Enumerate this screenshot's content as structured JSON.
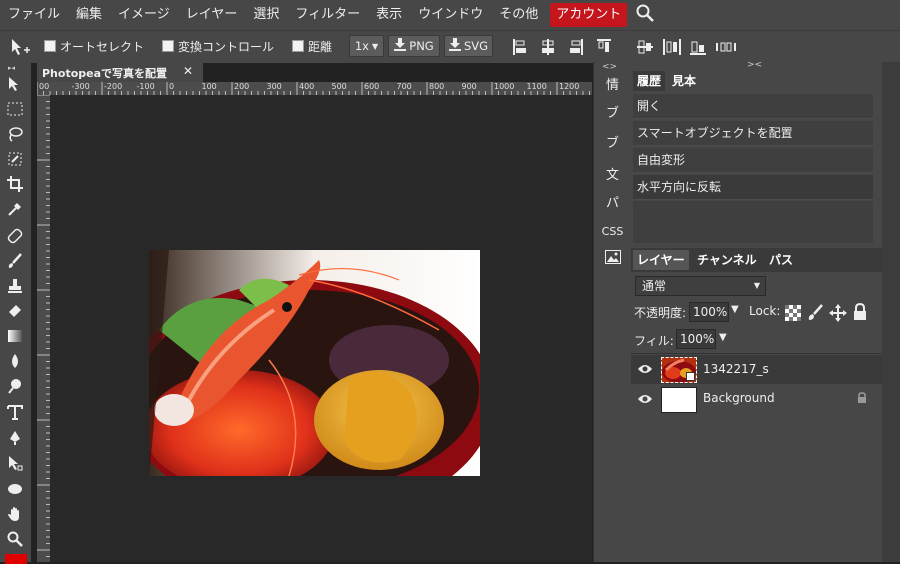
{
  "menu": {
    "items": [
      "ファイル",
      "編集",
      "イメージ",
      "レイヤー",
      "選択",
      "フィルター",
      "表示",
      "ウインドウ",
      "その他"
    ],
    "account": "アカウント"
  },
  "options": {
    "auto_select": "オートセレクト",
    "transform_controls": "変換コントロール",
    "distance": "距離",
    "zoom_select": "1x",
    "png_button": "PNG",
    "svg_button": "SVG"
  },
  "document": {
    "tab_title": "Photopeaで写真を配置",
    "close_glyph": "✕",
    "ruler_ticks": [
      "00",
      "-300",
      "-200",
      "-100",
      "0",
      "100",
      "200",
      "300",
      "400",
      "500",
      "600",
      "700",
      "800",
      "900",
      "1000",
      "1100",
      "1200",
      "1300"
    ]
  },
  "mini_panel": {
    "collapse": "<>",
    "items": [
      "情",
      "ブ",
      "ブ",
      "文",
      "パ",
      "CSS"
    ]
  },
  "history": {
    "collapse": "><",
    "tabs": [
      "履歴",
      "見本"
    ],
    "entries": [
      "開く",
      "スマートオブジェクトを配置",
      "自由変形",
      "水平方向に反転"
    ]
  },
  "layers": {
    "tabs": [
      "レイヤー",
      "チャンネル",
      "パス"
    ],
    "blend_mode": "通常",
    "opacity_label": "不透明度:",
    "opacity_value": "100%",
    "lock_label": "Lock:",
    "fill_label": "フィル:",
    "fill_value": "100%",
    "items": [
      {
        "name": "1342217_s",
        "visible": true,
        "smart_object": true
      },
      {
        "name": "Background",
        "visible": true,
        "locked": true
      }
    ]
  },
  "colors": {
    "account_red": "#c4161c",
    "panel": "#474747",
    "canvas_bg": "#282828",
    "foreground_swatch": "#e00000"
  }
}
